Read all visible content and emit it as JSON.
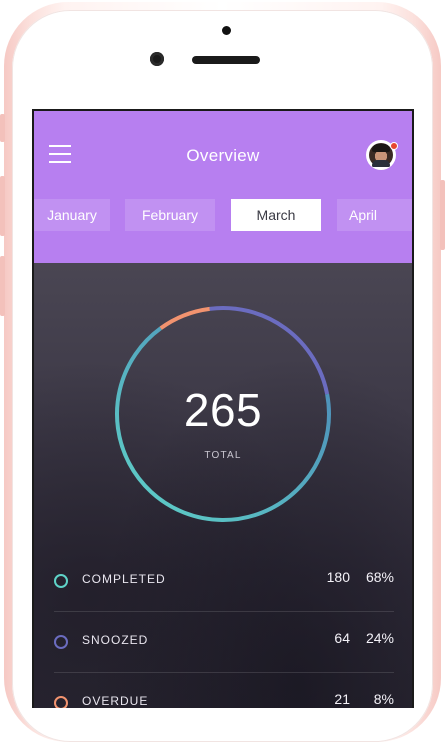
{
  "header": {
    "title": "Overview"
  },
  "months": [
    "January",
    "February",
    "March",
    "April"
  ],
  "selected_month": "March",
  "summary": {
    "total_value": "265",
    "total_label": "TOTAL"
  },
  "stats": [
    {
      "label": "COMPLETED",
      "count": "180",
      "percent": "68%",
      "color": "#5fd3c8",
      "fraction": 0.68
    },
    {
      "label": "SNOOZED",
      "count": "64",
      "percent": "24%",
      "color": "#6b6cc0",
      "fraction": 0.24
    },
    {
      "label": "OVERDUE",
      "count": "21",
      "percent": "8%",
      "color": "#f2936f",
      "fraction": 0.08
    }
  ],
  "colors": {
    "accent": "#b77ff0",
    "completed": "#5fd3c8",
    "snoozed": "#6b6cc0",
    "overdue": "#f2936f"
  },
  "icons": {
    "menu": "hamburger-menu-icon",
    "avatar": "user-avatar",
    "notification": "notification-dot"
  }
}
